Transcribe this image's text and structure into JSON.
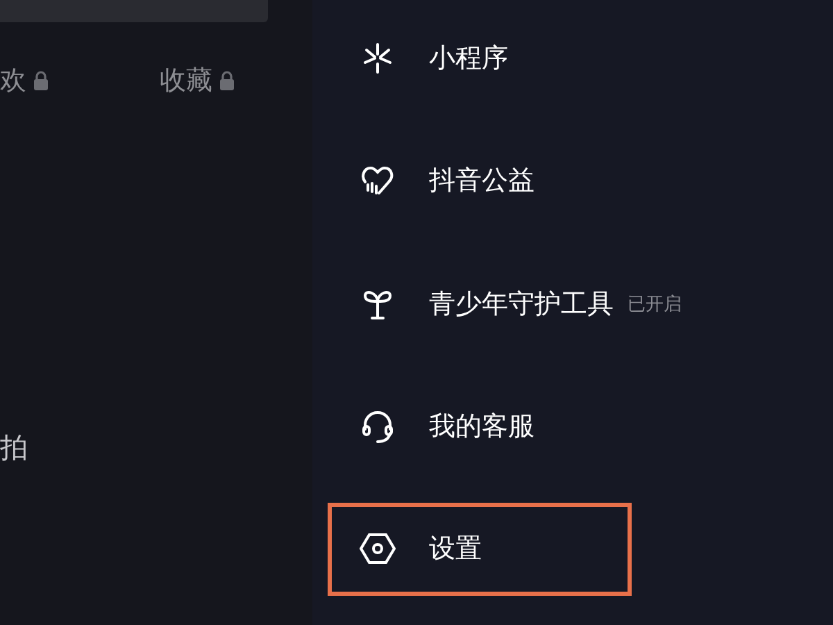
{
  "profile_tabs": [
    {
      "label": "欢",
      "locked": true
    },
    {
      "label": "收藏",
      "locked": true
    }
  ],
  "profile_label": "拍",
  "menu": [
    {
      "label": "小程序",
      "highlighted": false
    },
    {
      "label": "抖音公益",
      "highlighted": false
    },
    {
      "label": "青少年守护工具",
      "status": "已开启",
      "highlighted": false
    },
    {
      "label": "我的客服",
      "highlighted": false
    },
    {
      "label": "设置",
      "highlighted": true
    }
  ]
}
